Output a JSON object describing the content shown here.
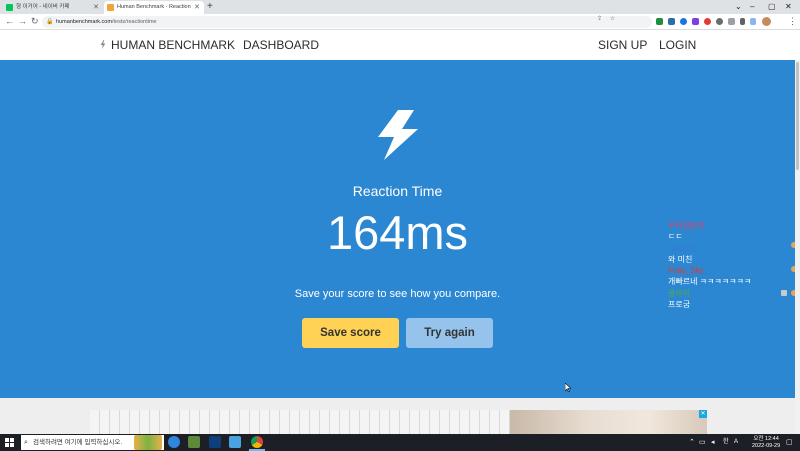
{
  "browser": {
    "tabs": [
      {
        "title": "형 이거어 - 네이버 카페",
        "active": false
      },
      {
        "title": "Human Benchmark - Reaction",
        "active": true
      }
    ],
    "new_tab_glyph": "+",
    "url_host": "humanbenchmark.com",
    "url_path": "/tests/reactiontime"
  },
  "site": {
    "logo_text": "HUMAN BENCHMARK",
    "nav": {
      "dashboard": "DASHBOARD",
      "sign_up": "SIGN UP",
      "login": "LOGIN"
    }
  },
  "test": {
    "title": "Reaction Time",
    "score": "164ms",
    "tagline": "Save your score to see how you compare.",
    "save_label": "Save score",
    "retry_label": "Try again"
  },
  "chat": [
    {
      "user": "우유얌송이",
      "message": "ㄷㄷ",
      "color": "#e0426b"
    },
    {
      "user": "DrLinus",
      "message": "와 미친",
      "color": "#3a78d8"
    },
    {
      "user": "Foby_Sky",
      "message": "개빠르네 ㅋㅋㅋㅋㅋㅋㅋ",
      "color": "#e8372c"
    },
    {
      "user": "쿨바위",
      "message": "프로굼",
      "color": "#4fa94d"
    }
  ],
  "taskbar": {
    "search_placeholder": "검색하려면 여기에 입력하십시오.",
    "clock_label": "오전 12:44",
    "date": "2022-09-29"
  },
  "colors": {
    "hero_blue": "#2b87d1",
    "save_button": "#ffd154",
    "retry_button": "#95c3ec",
    "taskbar": "#1c1f26"
  },
  "icons": {
    "logo": "lightning-bolt-icon",
    "hero": "lightning-bolt-icon",
    "start": "windows-start-icon"
  }
}
